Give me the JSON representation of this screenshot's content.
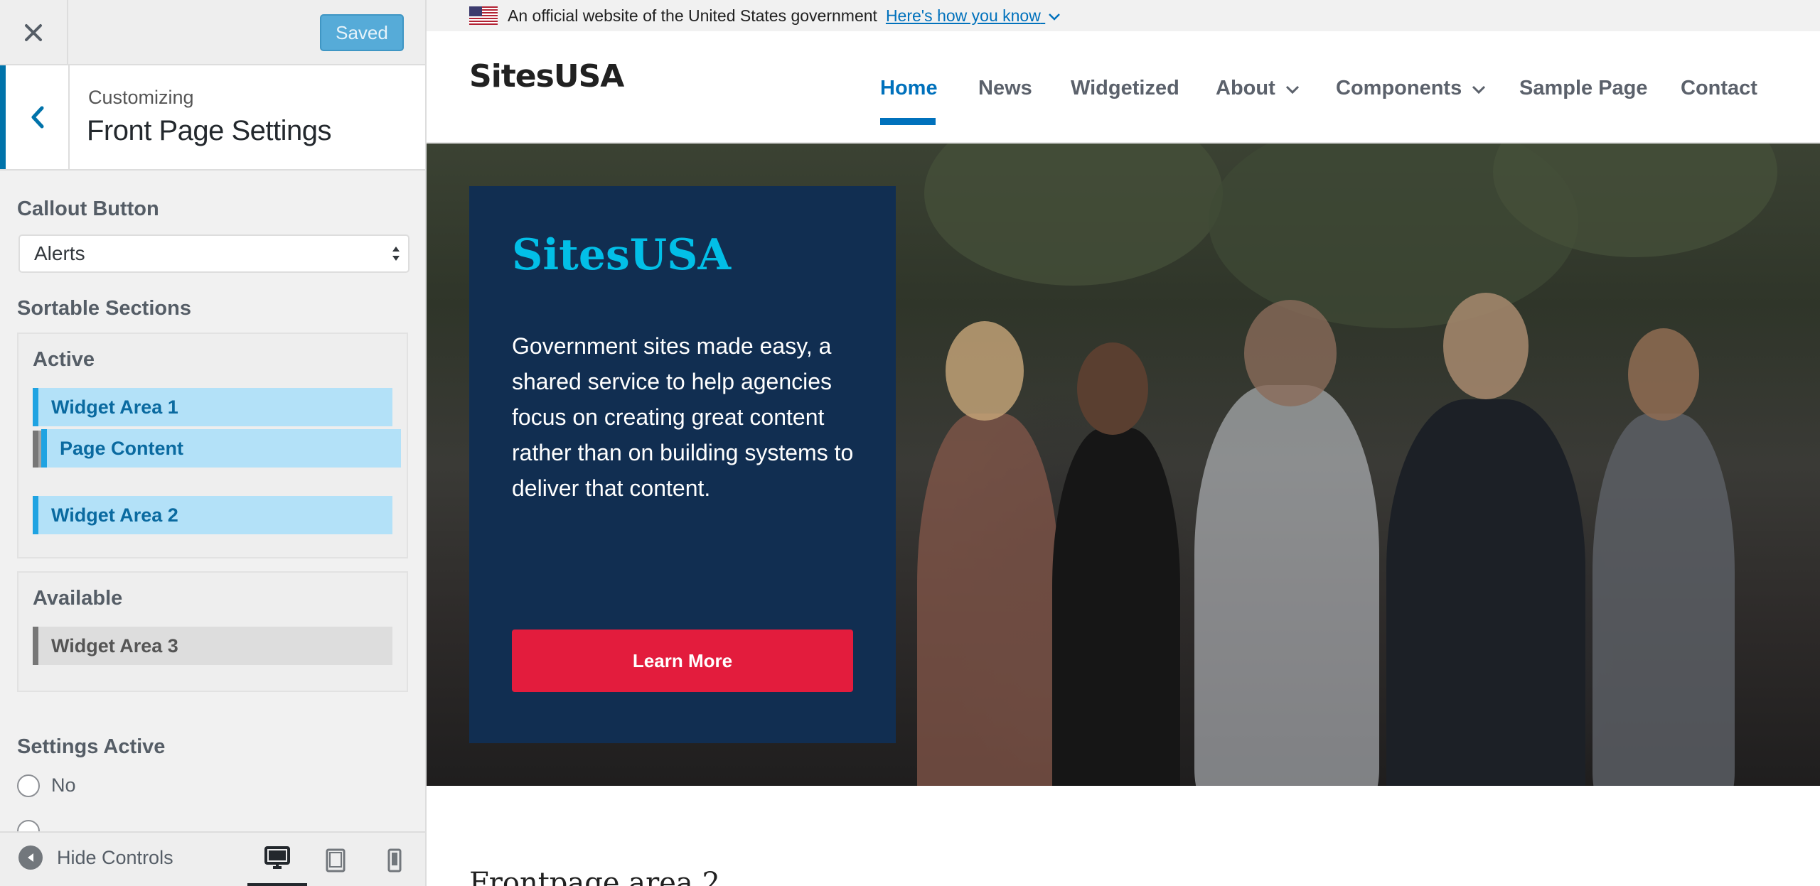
{
  "customizer": {
    "close_icon": "close-icon",
    "saved_label": "Saved",
    "breadcrumb": "Customizing",
    "section_title": "Front Page Settings",
    "callout_label": "Callout Button",
    "callout_value": "Alerts",
    "sortable_label": "Sortable Sections",
    "active_title": "Active",
    "active_items": [
      "Widget Area 1",
      "Page Content",
      "Widget Area 2"
    ],
    "available_title": "Available",
    "available_items": [
      "Widget Area 3"
    ],
    "settings_active_label": "Settings Active",
    "radio_no": "No",
    "hide_controls": "Hide Controls",
    "devices": [
      "desktop",
      "tablet",
      "mobile"
    ],
    "accent_color": "#0073aa"
  },
  "site": {
    "gov_banner_text": "An official website of the United States government",
    "gov_banner_link": "Here's how you know",
    "logo": "SitesUSA",
    "nav": [
      "Home",
      "News",
      "Widgetized",
      "About",
      "Components",
      "Sample Page",
      "Contact"
    ],
    "nav_current": "Home",
    "hero_title": "SitesUSA",
    "hero_text": "Government sites made easy, a shared service to help agencies focus on creating great content rather than on building systems to deliver that content.",
    "hero_button": "Learn More",
    "frontpage_area": "Frontpage area 2",
    "colors": {
      "primary": "#0071bc",
      "hero_card": "#112e51",
      "hero_title": "#02bfe7",
      "button": "#e31c3d"
    }
  }
}
